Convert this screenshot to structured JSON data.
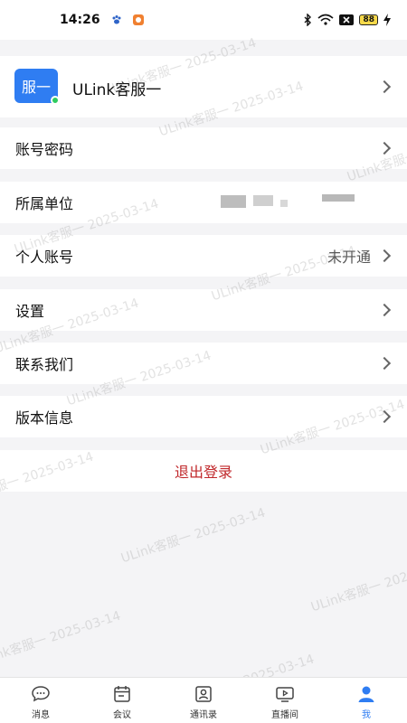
{
  "status": {
    "time": "14:26",
    "battery": "88"
  },
  "profile": {
    "avatar_text": "服一",
    "name": "ULink客服一"
  },
  "menu": {
    "account_password": "账号密码",
    "organization": "所属单位",
    "personal_account": "个人账号",
    "personal_account_value": "未开通",
    "settings": "设置",
    "contact_us": "联系我们",
    "version_info": "版本信息",
    "logout": "退出登录"
  },
  "watermark": "ULink客服一 2025-03-14",
  "tabbar": {
    "items": [
      {
        "label": "消息",
        "icon": "chat-bubble-icon"
      },
      {
        "label": "会议",
        "icon": "calendar-icon"
      },
      {
        "label": "通讯录",
        "icon": "contacts-icon"
      },
      {
        "label": "直播间",
        "icon": "tv-play-icon"
      },
      {
        "label": "我",
        "icon": "person-icon"
      }
    ],
    "active_index": 4
  },
  "colors": {
    "accent": "#2f7df2",
    "logout": "#c0282b",
    "online": "#2ecb5f"
  }
}
